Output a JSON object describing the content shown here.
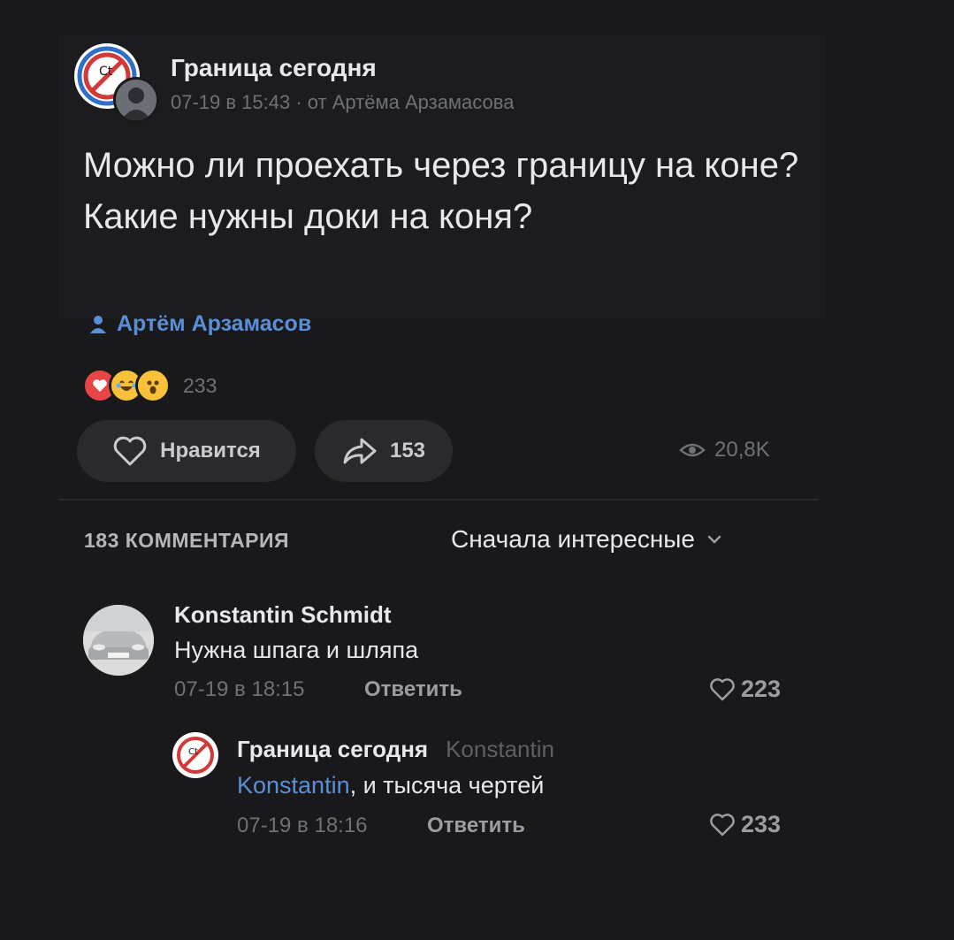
{
  "post": {
    "group_name": "Граница сегодня",
    "date": "07-19 в 15:43",
    "separator": " · ",
    "author_line": "от Артёма Арзамасова",
    "text": "Можно ли проехать через границу на коне? Какие нужны доки на коня?",
    "signature": "Артём Арзамасов",
    "avatar_logo_text": "Ct",
    "reactions": {
      "icons": [
        "heart-reaction-icon",
        "laughing-tears-icon",
        "surprised-face-icon"
      ],
      "count": "233"
    },
    "like_label": "Нравится",
    "shares": "153",
    "views": "20,8K"
  },
  "comments_header": {
    "count_label": "183 КОММЕНТАРИЯ",
    "sort_label": "Сначала интересные"
  },
  "comments": [
    {
      "author": "Konstantin Schmidt",
      "text": "Нужна шпага и шляпа",
      "date": "07-19 в 18:15",
      "reply_label": "Ответить",
      "likes": "223"
    }
  ],
  "reply": {
    "author": "Граница сегодня",
    "reply_to": "Konstantin",
    "mention": "Konstantin",
    "text": ", и тысяча чертей",
    "date": "07-19 в 18:16",
    "reply_label": "Ответить",
    "likes": "233"
  },
  "colors": {
    "background": "#19191b",
    "accent_link": "#5a8fd8",
    "muted": "#6d7178",
    "pill": "#2a2a2d"
  }
}
